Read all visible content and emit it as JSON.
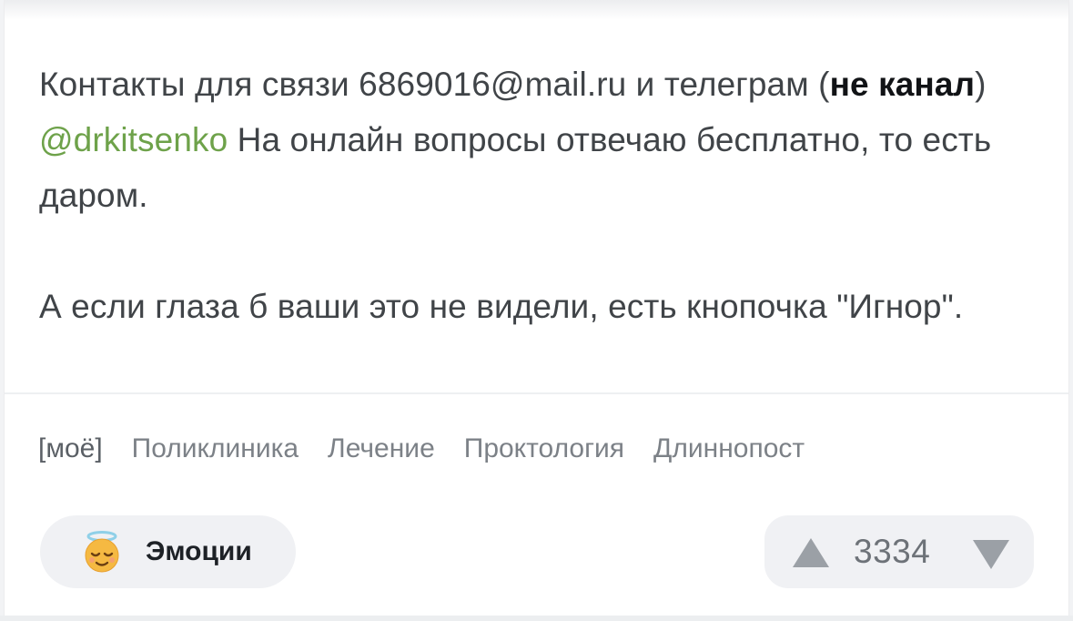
{
  "post": {
    "paragraph1": {
      "part1": "Контакты для связи 6869016@mail.ru и телеграм (",
      "bold": "не канал",
      "part2": ") ",
      "link": "@drkitsenko",
      "part3": " На онлайн вопросы отвечаю бесплатно, то есть даром."
    },
    "paragraph2": "А если глаза б ваши это не видели, есть кнопочка \"Игнор\"."
  },
  "tags": [
    "[моё]",
    "Поликлиника",
    "Лечение",
    "Проктология",
    "Длиннопост"
  ],
  "emotions": {
    "label": "Эмоции",
    "icon": "angel-emoji-icon"
  },
  "rating": {
    "score": "3334",
    "up_icon": "triangle-up-icon",
    "down_icon": "triangle-down-icon"
  },
  "colors": {
    "link": "#6ea24a",
    "text": "#404448",
    "tag": "#7c8187",
    "pill_bg": "#f0f1f4"
  }
}
